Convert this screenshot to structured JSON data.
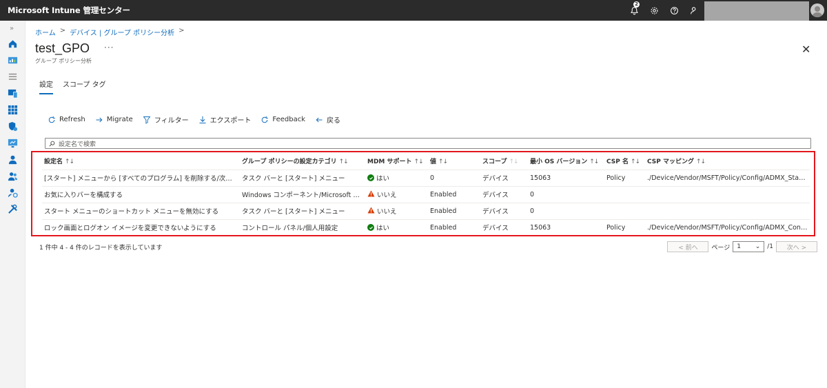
{
  "app": {
    "title": "Microsoft Intune 管理センター",
    "notification_count": "2"
  },
  "breadcrumb": [
    "ホーム",
    "デバイス | グループ ポリシー分析"
  ],
  "page": {
    "title": "test_GPO",
    "subtitle": "グループ ポリシー分析"
  },
  "tabs": [
    {
      "label": "設定",
      "active": true
    },
    {
      "label": "スコープ タグ",
      "active": false
    }
  ],
  "toolbar": {
    "refresh": "Refresh",
    "migrate": "Migrate",
    "filter": "フィルター",
    "export": "エクスポート",
    "feedback": "Feedback",
    "back": "戻る"
  },
  "search": {
    "placeholder": "設定名で検索"
  },
  "table": {
    "columns": [
      "設定名",
      "グループ ポリシーの設定カテゴリ",
      "MDM サポート",
      "値",
      "スコープ",
      "最小 OS バージョン",
      "CSP 名",
      "CSP マッピング"
    ],
    "sort_symbol": "↑↓",
    "rows": [
      {
        "name": "[スタート] メニューから [すべてのプログラム] を削除する/次の操作から ...",
        "category": "タスク バーと [スタート] メニュー",
        "mdm": "はい",
        "mdm_status": "ok",
        "value": "0",
        "scope": "デバイス",
        "min_os": "15063",
        "csp_name": "Policy",
        "csp_mapping": "./Device/Vendor/MSFT/Policy/Config/ADMX_StartMenu/..."
      },
      {
        "name": "お気に入りバーを構成する",
        "category": "Windows コンポーネント/Microsoft Edge",
        "mdm": "いいえ",
        "mdm_status": "warn",
        "value": "Enabled",
        "scope": "デバイス",
        "min_os": "0",
        "csp_name": "",
        "csp_mapping": ""
      },
      {
        "name": "スタート メニューのショートカット メニューを無効にする",
        "category": "タスク バーと [スタート] メニュー",
        "mdm": "いいえ",
        "mdm_status": "warn",
        "value": "Enabled",
        "scope": "デバイス",
        "min_os": "0",
        "csp_name": "",
        "csp_mapping": ""
      },
      {
        "name": "ロック画面とログオン イメージを変更できないようにする",
        "category": "コントロール パネル/個人用設定",
        "mdm": "はい",
        "mdm_status": "ok",
        "value": "Enabled",
        "scope": "デバイス",
        "min_os": "15063",
        "csp_name": "Policy",
        "csp_mapping": "./Device/Vendor/MSFT/Policy/Config/ADMX_ControlPanel/..."
      }
    ]
  },
  "footer": {
    "records": "1 件中 4 - 4 件のレコードを表示しています",
    "prev": "< 前へ",
    "page_label": "ページ",
    "page_value": "1",
    "page_total": "/1",
    "next": "次へ >"
  },
  "colors": {
    "topbar": "#2b2b2b",
    "accent": "#0f6cbd",
    "highlight": "#e3161b",
    "ok": "#107c10",
    "warn": "#d83b01"
  }
}
